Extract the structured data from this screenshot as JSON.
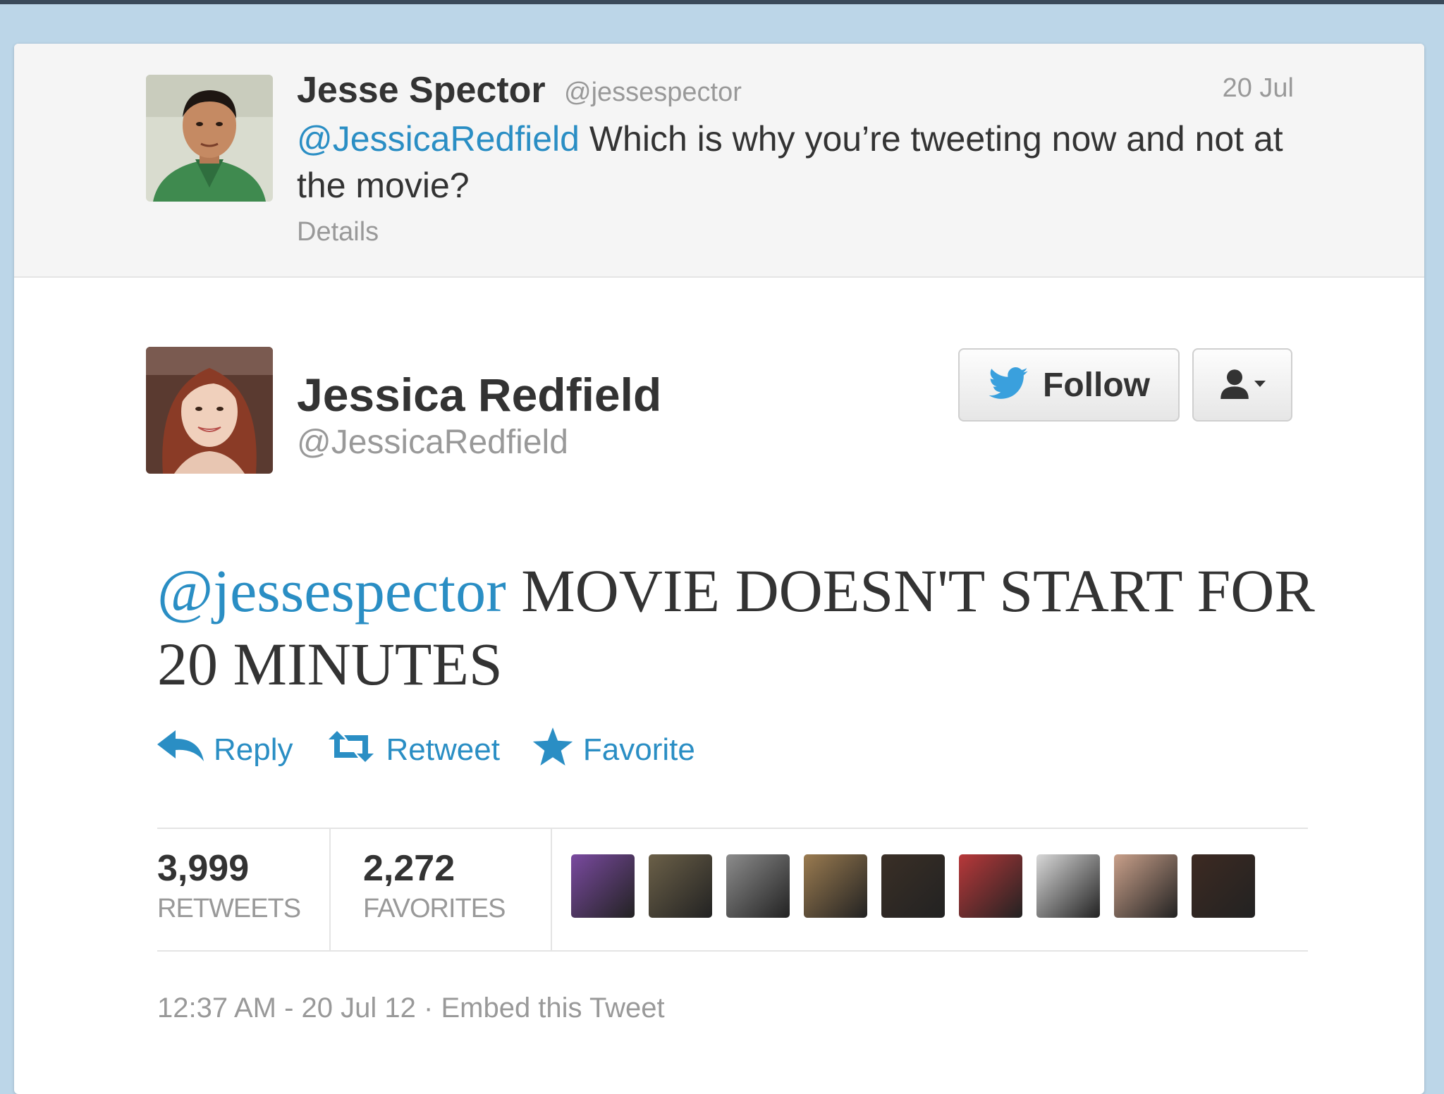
{
  "parent_tweet": {
    "author_name": "Jesse Spector",
    "author_handle": "@jessespector",
    "timestamp": "20 Jul",
    "mention": "@JessicaRedfield",
    "text": " Which is why you’re tweeting now and not at the movie?",
    "details_link": "Details",
    "avatar": "profile-photo"
  },
  "main_tweet": {
    "author_name": "Jessica Redfield",
    "author_handle": "@JessicaRedfield",
    "avatar": "profile-photo",
    "follow_button": {
      "label": "Follow",
      "icon": "twitter-bird-icon"
    },
    "user_actions_button": {
      "icon": "user-icon",
      "caret": "caret-down-icon"
    },
    "mention": "@jessespector",
    "text": " MOVIE DOESN'T START FOR 20 MINUTES",
    "actions": [
      {
        "label": "Reply",
        "icon": "reply-arrow-icon"
      },
      {
        "label": "Retweet",
        "icon": "retweet-icon"
      },
      {
        "label": "Favorite",
        "icon": "star-icon"
      }
    ],
    "stats": {
      "retweets": {
        "count": "3,999",
        "label": "RETWEETS"
      },
      "favorites": {
        "count": "2,272",
        "label": "FAVORITES"
      }
    },
    "favoriter_avatars": [
      {
        "color": "#7a4aa0"
      },
      {
        "color": "#6b6048"
      },
      {
        "color": "#8c8c8c"
      },
      {
        "color": "#9a7b50"
      },
      {
        "color": "#3a2f26"
      },
      {
        "color": "#b8383a"
      },
      {
        "color": "#d8d8d8"
      },
      {
        "color": "#c9a08a"
      },
      {
        "color": "#3d2a22"
      }
    ],
    "footer": {
      "time": "12:37 AM - 20 Jul 12",
      "separator": " · ",
      "embed_link": "Embed this Tweet"
    }
  },
  "colors": {
    "link": "#2a8ec4",
    "muted": "#999999",
    "text": "#333333",
    "page_background": "#bcd6e8"
  }
}
